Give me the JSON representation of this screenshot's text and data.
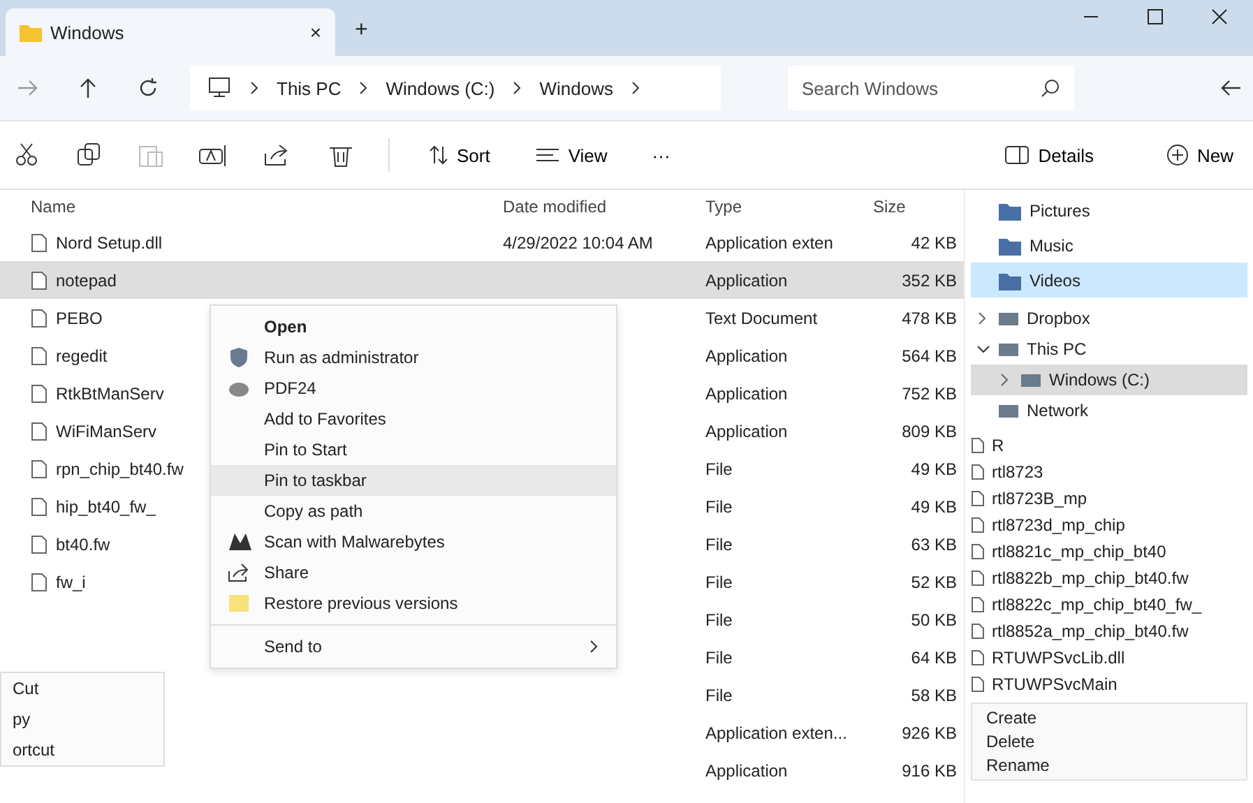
{
  "tab": {
    "title": "Windows",
    "close": "×",
    "new_tab": "+"
  },
  "address": {
    "crumbs": [
      "This PC",
      "Windows (C:)",
      "Windows"
    ],
    "search": {
      "placeholder": "Search Windows"
    }
  },
  "toolbar": {
    "sort": "Sort",
    "view": "View",
    "more": "···",
    "details": "Details",
    "new": "New"
  },
  "columns": [
    "Name",
    "Date modified",
    "Type",
    "Size"
  ],
  "rows": [
    {
      "name": "Nord Setup.dll",
      "date": "4/29/2022 10:04 AM",
      "type": "Application exten",
      "size": "42 KB",
      "selected": false
    },
    {
      "name": "notepad",
      "date": "",
      "type": "Application",
      "size": "352 KB",
      "selected": true
    },
    {
      "name": "PEBO",
      "date": "",
      "type": "Text Document",
      "size": "478 KB",
      "selected": false
    },
    {
      "name": "regedit",
      "date": "",
      "type": "Application",
      "size": "564 KB",
      "selected": false
    },
    {
      "name": "RtkBtManServ",
      "date": "",
      "type": "Application",
      "size": "752 KB",
      "selected": false
    },
    {
      "name": "WiFiManServ",
      "date": "",
      "type": "Application",
      "size": "809 KB",
      "selected": false
    },
    {
      "name": "rpn_chip_bt40.fw",
      "date": "",
      "type": "File",
      "size": "49 KB",
      "selected": false
    },
    {
      "name": "hip_bt40_fw_",
      "date": "",
      "type": "File",
      "size": "49 KB",
      "selected": false
    },
    {
      "name": "bt40.fw",
      "date": "",
      "type": "File",
      "size": "63 KB",
      "selected": false
    },
    {
      "name": "fw_i",
      "date": "",
      "type": "File",
      "size": "52 KB",
      "selected": false
    },
    {
      "name": "",
      "date": "",
      "type": "File",
      "size": "50 KB",
      "selected": false
    },
    {
      "name": "",
      "date": "",
      "type": "File",
      "size": "64 KB",
      "selected": false
    },
    {
      "name": "",
      "date": "",
      "type": "File",
      "size": "58 KB",
      "selected": false
    },
    {
      "name": "",
      "date": "",
      "type": "Application exten...",
      "size": "926 KB",
      "selected": false
    },
    {
      "name": "",
      "date": "",
      "type": "Application",
      "size": "916 KB",
      "selected": false
    }
  ],
  "context_menu": [
    {
      "label": "Open",
      "kind": "bold",
      "selected": false
    },
    {
      "label": "Run as administrator",
      "kind": "shield",
      "selected": false
    },
    {
      "label": "PDF24",
      "kind": "pdf",
      "selected": false
    },
    {
      "label": "Add to Favorites",
      "kind": "plain",
      "selected": false
    },
    {
      "label": "Pin to Start",
      "kind": "plain",
      "selected": false
    },
    {
      "label": "Pin to taskbar",
      "kind": "plain",
      "selected": true
    },
    {
      "label": "Copy as path",
      "kind": "plain",
      "selected": false
    },
    {
      "label": "Scan with Malwarebytes",
      "kind": "scan",
      "selected": false
    },
    {
      "label": "Share",
      "kind": "share",
      "selected": false
    },
    {
      "label": "Restore previous versions",
      "kind": "restore",
      "selected": false
    },
    {
      "label": "Send to",
      "kind": "submenu",
      "selected": false
    }
  ],
  "side_menu": [
    "Cut",
    "py",
    "ortcut"
  ],
  "quick_access": [
    {
      "label": "Pictures",
      "selected": false
    },
    {
      "label": "Music",
      "selected": false
    },
    {
      "label": "Videos",
      "selected": true
    }
  ],
  "tree": [
    {
      "label": "Dropbox",
      "kind": "node",
      "expanded": false,
      "selected": false
    },
    {
      "label": "This PC",
      "kind": "node",
      "expanded": true,
      "selected": false,
      "children": [
        {
          "label": "Windows (C:)",
          "kind": "node",
          "expanded": false,
          "selected": true
        }
      ]
    },
    {
      "label": "Network",
      "kind": "leaf",
      "selected": false
    }
  ],
  "side_files": [
    "R",
    "rtl8723",
    "rtl8723B_mp",
    "rtl8723d_mp_chip",
    "rtl8821c_mp_chip_bt40",
    "rtl8822b_mp_chip_bt40.fw",
    "rtl8822c_mp_chip_bt40_fw_",
    "rtl8852a_mp_chip_bt40.fw",
    "RTUWPSvcLib.dll",
    "RTUWPSvcMain"
  ],
  "mini_menu": [
    "Create",
    "Delete",
    "Rename"
  ]
}
